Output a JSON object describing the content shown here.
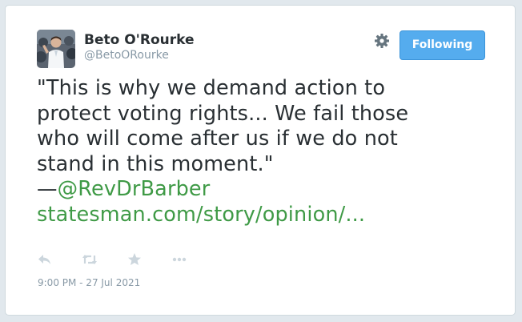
{
  "author": {
    "name": "Beto O'Rourke",
    "handle": "@BetoORourke",
    "avatar_icon": "profile-photo"
  },
  "header": {
    "settings_icon": "gear-icon",
    "follow_button_label": "Following"
  },
  "tweet": {
    "lines": [
      "\"This is why we demand action to",
      "protect voting rights... We fail those",
      "who will come after us if we do not",
      "stand in this moment.\""
    ],
    "dash": "—",
    "mention": "@RevDrBarber",
    "link": "statesman.com/story/opinion/..."
  },
  "actions": {
    "reply_icon": "reply-icon",
    "retweet_icon": "retweet-icon",
    "favorite_icon": "star-icon",
    "more_icon": "more-icon"
  },
  "timestamp": "9:00 PM - 27 Jul 2021",
  "colors": {
    "link": "#3f9a46",
    "button": "#55acee",
    "text": "#292f33",
    "muted": "#8899a6",
    "icon": "#ccd6dd"
  }
}
